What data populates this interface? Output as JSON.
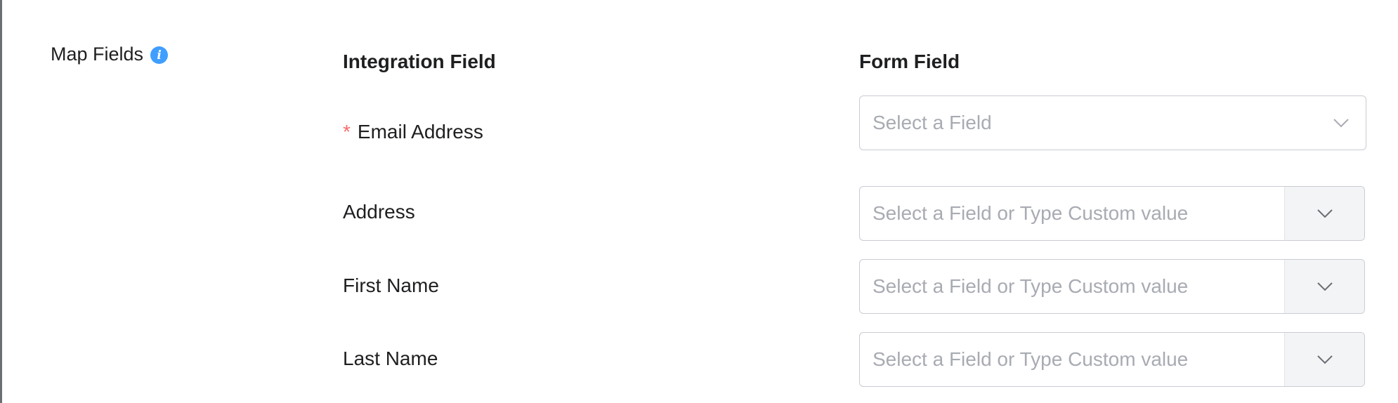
{
  "section": {
    "label": "Map Fields",
    "info_icon": "info-icon",
    "accent": "#409eff"
  },
  "headers": {
    "integration_field": "Integration Field",
    "form_field": "Form Field"
  },
  "rows": [
    {
      "label": "Email Address",
      "required": true,
      "required_mark": "*",
      "placeholder": "Select a Field"
    },
    {
      "label": "Address",
      "required": false,
      "placeholder": "Select a Field or Type Custom value"
    },
    {
      "label": "First Name",
      "required": false,
      "placeholder": "Select a Field or Type Custom value"
    },
    {
      "label": "Last Name",
      "required": false,
      "placeholder": "Select a Field or Type Custom value"
    }
  ],
  "colors": {
    "required": "#f56c6c",
    "placeholder": "#a8abb2",
    "border": "#c9ccd3"
  }
}
